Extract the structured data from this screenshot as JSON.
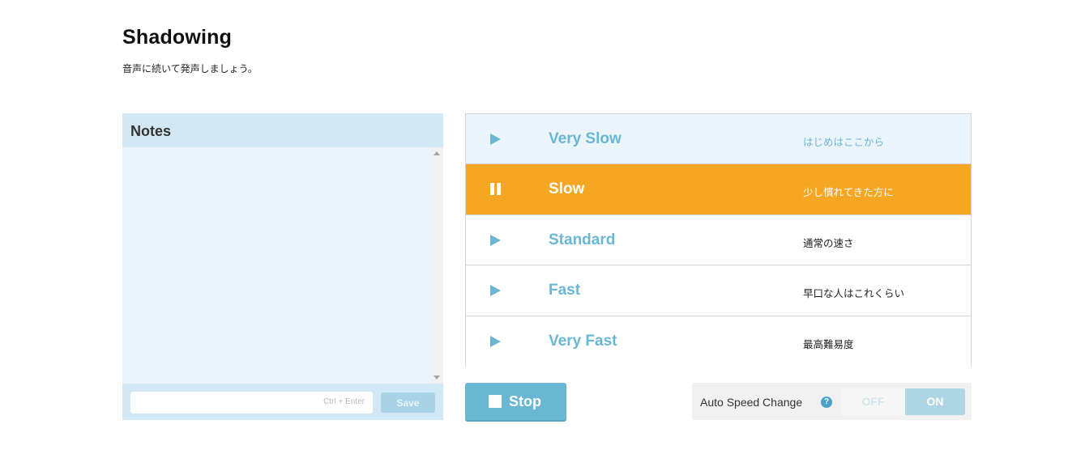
{
  "header": {
    "title": "Shadowing",
    "subtitle": "音声に続いて発声しましょう。"
  },
  "notes": {
    "title": "Notes",
    "textarea_value": "",
    "input_value": "",
    "input_hint": "Ctrl + Enter",
    "save_label": "Save"
  },
  "speeds": [
    {
      "label": "Very Slow",
      "description": "はじめはここから",
      "state": "highlighted",
      "icon": "play-icon"
    },
    {
      "label": "Slow",
      "description": "少し慣れてきた方に",
      "state": "playing",
      "icon": "pause-icon"
    },
    {
      "label": "Standard",
      "description": "通常の速さ",
      "state": "idle",
      "icon": "play-icon"
    },
    {
      "label": "Fast",
      "description": "早口な人はこれくらい",
      "state": "idle",
      "icon": "play-icon"
    },
    {
      "label": "Very Fast",
      "description": "最高難易度",
      "state": "idle",
      "icon": "play-icon"
    }
  ],
  "controls": {
    "stop_label": "Stop",
    "auto_speed_label": "Auto Speed Change",
    "help_glyph": "?",
    "toggle_off_label": "OFF",
    "toggle_on_label": "ON",
    "toggle_selected": "ON"
  },
  "colors": {
    "accent": "#69b7d3",
    "active_row": "#f5a623",
    "notes_header": "#d2e8f4",
    "notes_body": "#ebf4fa"
  }
}
